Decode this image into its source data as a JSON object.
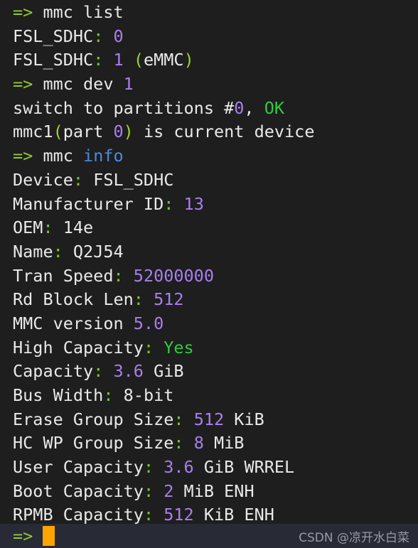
{
  "terminal": {
    "background_color": "#1e1e1e",
    "foreground_color": "#e9e9e9",
    "colors": {
      "prompt_green": "#8fcc2b",
      "ok_green": "#2fcc3e",
      "number_purple": "#a97ff0",
      "command_blue": "#4a8ae0",
      "colon_green": "#7ec62b",
      "paren_green": "#9ed22e",
      "cursor_orange": "#ffa400",
      "status_bar_bg": "#282a36",
      "watermark_gray": "#9a9aa2"
    },
    "lines": [
      {
        "id": "line-1",
        "segments": [
          {
            "t": "=>",
            "c": "c-prompt"
          },
          {
            "t": " mmc list",
            "c": "c-white"
          }
        ]
      },
      {
        "id": "line-2",
        "segments": [
          {
            "t": "FSL_SDHC",
            "c": "c-white"
          },
          {
            "t": ":",
            "c": "c-colon"
          },
          {
            "t": " ",
            "c": "c-white"
          },
          {
            "t": "0",
            "c": "c-purple"
          }
        ]
      },
      {
        "id": "line-3",
        "segments": [
          {
            "t": "FSL_SDHC",
            "c": "c-white"
          },
          {
            "t": ":",
            "c": "c-colon"
          },
          {
            "t": " ",
            "c": "c-white"
          },
          {
            "t": "1",
            "c": "c-purple"
          },
          {
            "t": " ",
            "c": "c-white"
          },
          {
            "t": "(",
            "c": "c-paren"
          },
          {
            "t": "eMMC",
            "c": "c-white"
          },
          {
            "t": ")",
            "c": "c-paren"
          }
        ]
      },
      {
        "id": "line-4",
        "segments": [
          {
            "t": "=>",
            "c": "c-prompt"
          },
          {
            "t": " mmc dev ",
            "c": "c-white"
          },
          {
            "t": "1",
            "c": "c-purple"
          }
        ]
      },
      {
        "id": "line-5",
        "segments": [
          {
            "t": "switch to partitions #",
            "c": "c-white"
          },
          {
            "t": "0",
            "c": "c-purple"
          },
          {
            "t": ", ",
            "c": "c-white"
          },
          {
            "t": "OK",
            "c": "c-green"
          }
        ]
      },
      {
        "id": "line-6",
        "segments": [
          {
            "t": "mmc1",
            "c": "c-white"
          },
          {
            "t": "(",
            "c": "c-paren"
          },
          {
            "t": "part ",
            "c": "c-white"
          },
          {
            "t": "0",
            "c": "c-purple"
          },
          {
            "t": ")",
            "c": "c-paren"
          },
          {
            "t": " is current device",
            "c": "c-white"
          }
        ]
      },
      {
        "id": "line-7",
        "segments": [
          {
            "t": "=>",
            "c": "c-prompt"
          },
          {
            "t": " mmc ",
            "c": "c-white"
          },
          {
            "t": "info",
            "c": "c-blue"
          }
        ]
      },
      {
        "id": "line-8",
        "segments": [
          {
            "t": "Device",
            "c": "c-white"
          },
          {
            "t": ":",
            "c": "c-colon"
          },
          {
            "t": " FSL_SDHC",
            "c": "c-white"
          }
        ]
      },
      {
        "id": "line-9",
        "segments": [
          {
            "t": "Manufacturer ID",
            "c": "c-white"
          },
          {
            "t": ":",
            "c": "c-colon"
          },
          {
            "t": " ",
            "c": "c-white"
          },
          {
            "t": "13",
            "c": "c-purple"
          }
        ]
      },
      {
        "id": "line-10",
        "segments": [
          {
            "t": "OEM",
            "c": "c-white"
          },
          {
            "t": ":",
            "c": "c-colon"
          },
          {
            "t": " 14e",
            "c": "c-white"
          }
        ]
      },
      {
        "id": "line-11",
        "segments": [
          {
            "t": "Name",
            "c": "c-white"
          },
          {
            "t": ":",
            "c": "c-colon"
          },
          {
            "t": " Q2J54",
            "c": "c-white"
          }
        ]
      },
      {
        "id": "line-12",
        "segments": [
          {
            "t": "Tran Speed",
            "c": "c-white"
          },
          {
            "t": ":",
            "c": "c-colon"
          },
          {
            "t": " ",
            "c": "c-white"
          },
          {
            "t": "52000000",
            "c": "c-purple"
          }
        ]
      },
      {
        "id": "line-13",
        "segments": [
          {
            "t": "Rd Block Len",
            "c": "c-white"
          },
          {
            "t": ":",
            "c": "c-colon"
          },
          {
            "t": " ",
            "c": "c-white"
          },
          {
            "t": "512",
            "c": "c-purple"
          }
        ]
      },
      {
        "id": "line-14",
        "segments": [
          {
            "t": "MMC version ",
            "c": "c-white"
          },
          {
            "t": "5.0",
            "c": "c-purple"
          }
        ]
      },
      {
        "id": "line-15",
        "segments": [
          {
            "t": "High Capacity",
            "c": "c-white"
          },
          {
            "t": ":",
            "c": "c-colon"
          },
          {
            "t": " ",
            "c": "c-white"
          },
          {
            "t": "Yes",
            "c": "c-green"
          }
        ]
      },
      {
        "id": "line-16",
        "segments": [
          {
            "t": "Capacity",
            "c": "c-white"
          },
          {
            "t": ":",
            "c": "c-colon"
          },
          {
            "t": " ",
            "c": "c-white"
          },
          {
            "t": "3.6",
            "c": "c-purple"
          },
          {
            "t": " GiB",
            "c": "c-white"
          }
        ]
      },
      {
        "id": "line-17",
        "segments": [
          {
            "t": "Bus Width",
            "c": "c-white"
          },
          {
            "t": ":",
            "c": "c-colon"
          },
          {
            "t": " 8-bit",
            "c": "c-white"
          }
        ]
      },
      {
        "id": "line-18",
        "segments": [
          {
            "t": "Erase Group Size",
            "c": "c-white"
          },
          {
            "t": ":",
            "c": "c-colon"
          },
          {
            "t": " ",
            "c": "c-white"
          },
          {
            "t": "512",
            "c": "c-purple"
          },
          {
            "t": " KiB",
            "c": "c-white"
          }
        ]
      },
      {
        "id": "line-19",
        "segments": [
          {
            "t": "HC WP Group Size",
            "c": "c-white"
          },
          {
            "t": ":",
            "c": "c-colon"
          },
          {
            "t": " ",
            "c": "c-white"
          },
          {
            "t": "8",
            "c": "c-purple"
          },
          {
            "t": " MiB",
            "c": "c-white"
          }
        ]
      },
      {
        "id": "line-20",
        "segments": [
          {
            "t": "User Capacity",
            "c": "c-white"
          },
          {
            "t": ":",
            "c": "c-colon"
          },
          {
            "t": " ",
            "c": "c-white"
          },
          {
            "t": "3.6",
            "c": "c-purple"
          },
          {
            "t": " GiB WRREL",
            "c": "c-white"
          }
        ]
      },
      {
        "id": "line-21",
        "segments": [
          {
            "t": "Boot Capacity",
            "c": "c-white"
          },
          {
            "t": ":",
            "c": "c-colon"
          },
          {
            "t": " ",
            "c": "c-white"
          },
          {
            "t": "2",
            "c": "c-purple"
          },
          {
            "t": " MiB ENH",
            "c": "c-white"
          }
        ]
      },
      {
        "id": "line-22",
        "segments": [
          {
            "t": "RPMB Capacity",
            "c": "c-white"
          },
          {
            "t": ":",
            "c": "c-colon"
          },
          {
            "t": " ",
            "c": "c-white"
          },
          {
            "t": "512",
            "c": "c-purple"
          },
          {
            "t": " KiB ENH",
            "c": "c-white"
          }
        ]
      }
    ]
  },
  "status_bar": {
    "prompt": "=>",
    "input_value": "",
    "cursor": "block-cursor",
    "watermark": "CSDN @凉开水白菜"
  }
}
